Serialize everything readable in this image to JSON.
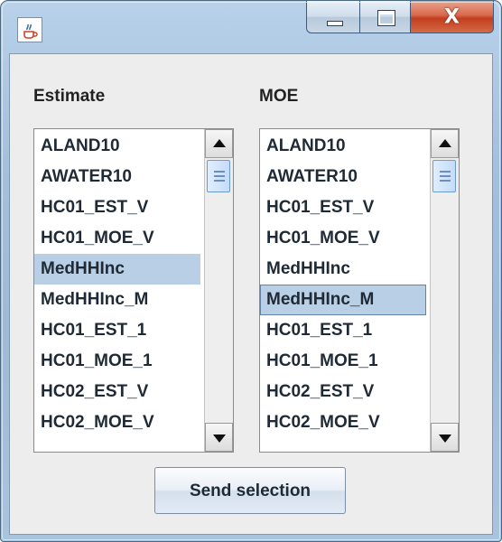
{
  "titlebar": {
    "app_icon": "java-coffee-cup-icon",
    "minimize_icon": "minimize-icon",
    "maximize_icon": "maximize-icon",
    "close_icon": "close-icon",
    "close_glyph": "X"
  },
  "estimate": {
    "header": "Estimate",
    "items": [
      "ALAND10",
      "AWATER10",
      "HC01_EST_V",
      "HC01_MOE_V",
      "MedHHInc",
      "MedHHInc_M",
      "HC01_EST_1",
      "HC01_MOE_1",
      "HC02_EST_V",
      "HC02_MOE_V"
    ],
    "selected_index": 4
  },
  "moe": {
    "header": "MOE",
    "items": [
      "ALAND10",
      "AWATER10",
      "HC01_EST_V",
      "HC01_MOE_V",
      "MedHHInc",
      "MedHHInc_M",
      "HC01_EST_1",
      "HC01_MOE_1",
      "HC02_EST_V",
      "HC02_MOE_V"
    ],
    "selected_index": 5
  },
  "actions": {
    "send_label": "Send selection"
  },
  "colors": {
    "selection": "#b8cfe5",
    "panel": "#ededed",
    "scroll_thumb": "#c5dcf7"
  }
}
